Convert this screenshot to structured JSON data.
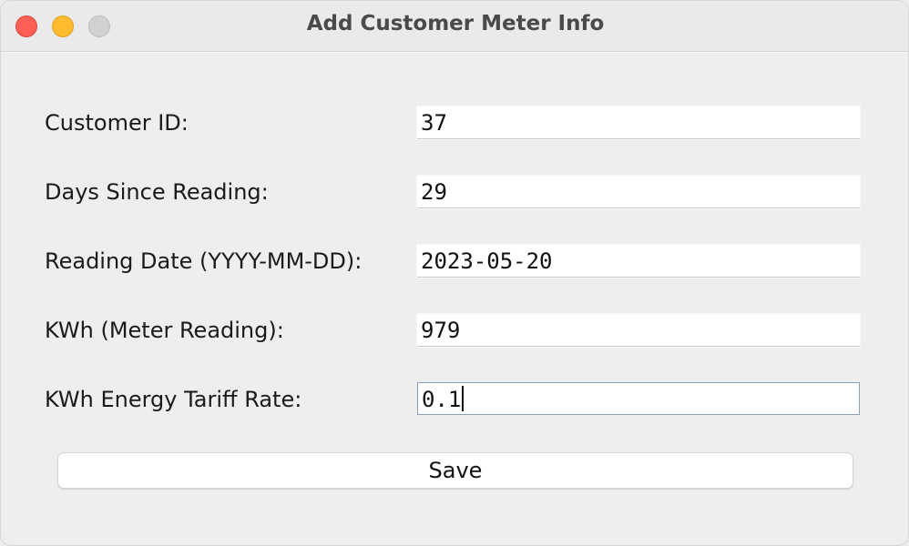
{
  "window": {
    "title": "Add Customer Meter Info"
  },
  "form": {
    "fields": [
      {
        "label": "Customer ID:",
        "value": "37"
      },
      {
        "label": "Days Since Reading:",
        "value": "29"
      },
      {
        "label": "Reading Date (YYYY-MM-DD):",
        "value": "2023-05-20"
      },
      {
        "label": "KWh (Meter Reading):",
        "value": "979"
      },
      {
        "label": "KWh Energy Tariff Rate:",
        "value": "0.1"
      }
    ],
    "save_label": "Save"
  }
}
